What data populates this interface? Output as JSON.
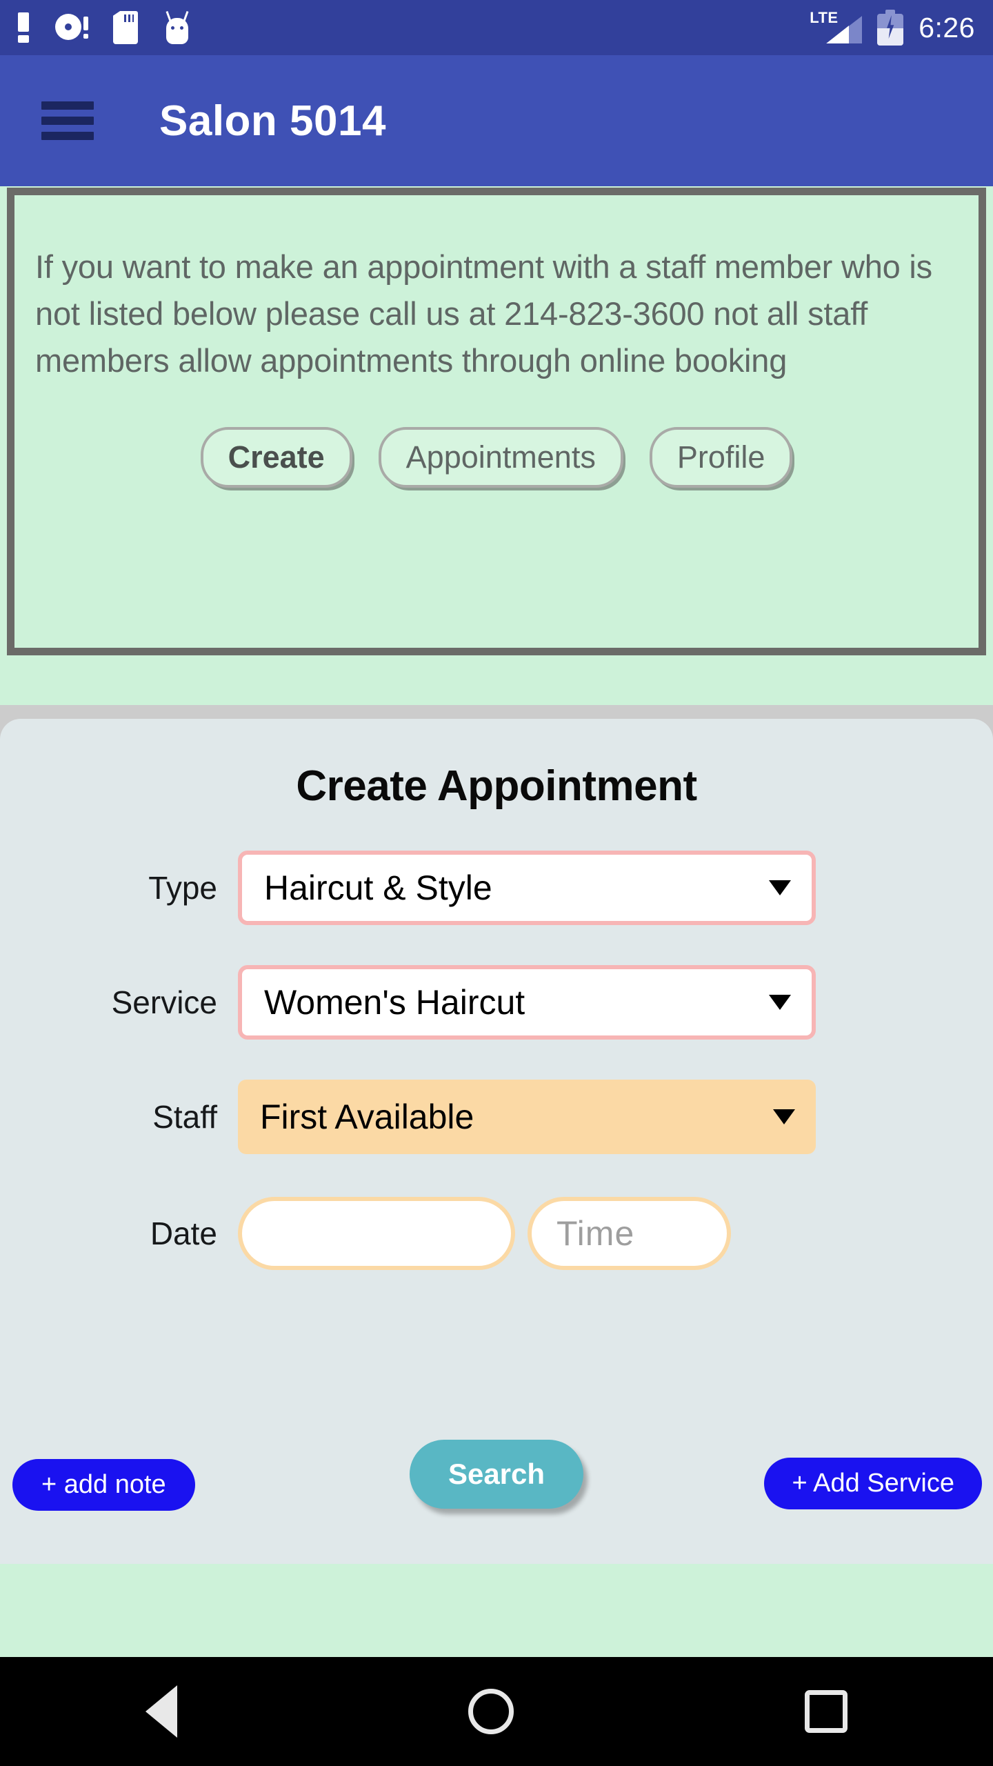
{
  "status_bar": {
    "time": "6:26",
    "network_label": "LTE",
    "left_icons": [
      "warning-exclamation-icon",
      "disc-alert-icon",
      "sd-card-icon",
      "android-droid-icon"
    ],
    "right_icons": [
      "lte-signal-icon",
      "battery-charging-icon"
    ]
  },
  "app_bar": {
    "menu_icon": "hamburger-menu-icon",
    "title": "Salon 5014"
  },
  "notice": {
    "text": "If you want to make an appointment with a staff member who is not listed below please call us at 214-823-3600 not all staff members allow appointments through online booking",
    "phone": "214-823-3600",
    "tabs": [
      {
        "label": "Create",
        "active": true
      },
      {
        "label": "Appointments",
        "active": false
      },
      {
        "label": "Profile",
        "active": false
      }
    ]
  },
  "form": {
    "title": "Create Appointment",
    "fields": [
      {
        "label": "Type",
        "value": "Haircut & Style",
        "style": "pink"
      },
      {
        "label": "Service",
        "value": "Women's Haircut",
        "style": "pink"
      },
      {
        "label": "Staff",
        "value": "First Available",
        "style": "orange"
      }
    ],
    "date_row": {
      "label": "Date",
      "date_value": "",
      "date_placeholder": "",
      "time_placeholder": "Time",
      "time_value": ""
    },
    "buttons": {
      "add_note": "+ add note",
      "search": "Search",
      "add_service": "+ Add Service"
    }
  },
  "nav_bar": {
    "back": "back-triangle-icon",
    "home": "home-circle-icon",
    "recents": "recents-square-icon"
  },
  "colors": {
    "status_bar": "#32409b",
    "app_bar": "#3f51b5",
    "mint": "#cdf2d9",
    "card": "#e0e8ea",
    "pink_border": "#f7b5b5",
    "orange": "#fbd9a5",
    "blue_button": "#1a12f0",
    "teal_button": "#59b7c4"
  }
}
